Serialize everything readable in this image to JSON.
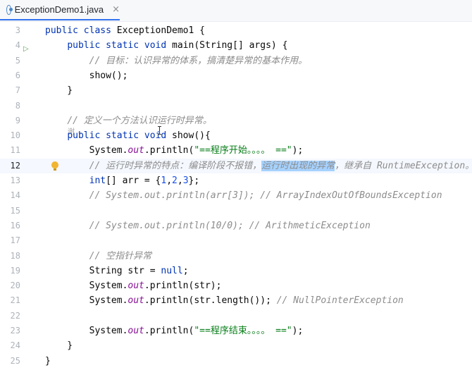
{
  "tab": {
    "title": "ExceptionDemo1.java",
    "close": "×"
  },
  "hint": "谢 ⌄",
  "lines": [
    {
      "n": "3",
      "seg": [
        [
          "kw",
          "public class "
        ],
        [
          "t",
          "ExceptionDemo1 {"
        ]
      ]
    },
    {
      "n": "4",
      "seg": [
        [
          "t",
          "    "
        ],
        [
          "kw",
          "public static void "
        ],
        [
          "t",
          "main(String[] args) {"
        ]
      ]
    },
    {
      "n": "5",
      "seg": [
        [
          "t",
          "        "
        ],
        [
          "cmt",
          "// 目标：认识异常的体系，搞清楚异常的基本作用。"
        ]
      ]
    },
    {
      "n": "6",
      "seg": [
        [
          "t",
          "        show();"
        ]
      ]
    },
    {
      "n": "7",
      "seg": [
        [
          "t",
          "    }"
        ]
      ]
    },
    {
      "n": "8",
      "seg": []
    },
    {
      "n": "9",
      "seg": [
        [
          "t",
          "    "
        ],
        [
          "cmt",
          "// 定义一个方法认识运行时异常。"
        ]
      ]
    },
    {
      "n": "10",
      "seg": [
        [
          "t",
          "    "
        ],
        [
          "kw",
          "public static void "
        ],
        [
          "t",
          "show(){"
        ]
      ]
    },
    {
      "n": "11",
      "seg": [
        [
          "t",
          "        System."
        ],
        [
          "field",
          "out"
        ],
        [
          "t",
          ".println("
        ],
        [
          "str",
          "\"==程序开始。。。。 ==\""
        ],
        [
          "t",
          ");"
        ]
      ]
    },
    {
      "n": "12",
      "seg": [
        [
          "t",
          "        "
        ],
        [
          "cmt",
          "// 运行时异常的特点：编译阶段不报错，"
        ],
        [
          "cmthl",
          "运行时出现的异常"
        ],
        [
          "cmt",
          "，继承自 RuntimeException。"
        ]
      ]
    },
    {
      "n": "13",
      "seg": [
        [
          "kw",
          "        int"
        ],
        [
          "t",
          "[] arr = {"
        ],
        [
          "num",
          "1"
        ],
        [
          "t",
          ","
        ],
        [
          "num",
          "2"
        ],
        [
          "t",
          ","
        ],
        [
          "num",
          "3"
        ],
        [
          "t",
          "};"
        ]
      ]
    },
    {
      "n": "14",
      "seg": [
        [
          "t",
          "        "
        ],
        [
          "cmt",
          "// System.out.println(arr[3]); // ArrayIndexOutOfBoundsException"
        ]
      ]
    },
    {
      "n": "15",
      "seg": []
    },
    {
      "n": "16",
      "seg": [
        [
          "t",
          "        "
        ],
        [
          "cmt",
          "// System.out.println(10/0); // ArithmeticException"
        ]
      ]
    },
    {
      "n": "17",
      "seg": []
    },
    {
      "n": "18",
      "seg": [
        [
          "t",
          "        "
        ],
        [
          "cmt",
          "// 空指针异常"
        ]
      ]
    },
    {
      "n": "19",
      "seg": [
        [
          "t",
          "        String str = "
        ],
        [
          "kw",
          "null"
        ],
        [
          "t",
          ";"
        ]
      ]
    },
    {
      "n": "20",
      "seg": [
        [
          "t",
          "        System."
        ],
        [
          "field",
          "out"
        ],
        [
          "t",
          ".println(str);"
        ]
      ]
    },
    {
      "n": "21",
      "seg": [
        [
          "t",
          "        System."
        ],
        [
          "field",
          "out"
        ],
        [
          "t",
          ".println(str.length()); "
        ],
        [
          "cmt",
          "// NullPointerException"
        ]
      ]
    },
    {
      "n": "22",
      "seg": []
    },
    {
      "n": "23",
      "seg": [
        [
          "t",
          "        System."
        ],
        [
          "field",
          "out"
        ],
        [
          "t",
          ".println("
        ],
        [
          "str",
          "\"==程序结束。。。。 ==\""
        ],
        [
          "t",
          ");"
        ]
      ]
    },
    {
      "n": "24",
      "seg": [
        [
          "t",
          "    }"
        ]
      ]
    },
    {
      "n": "25",
      "seg": [
        [
          "t",
          "}"
        ]
      ]
    }
  ]
}
